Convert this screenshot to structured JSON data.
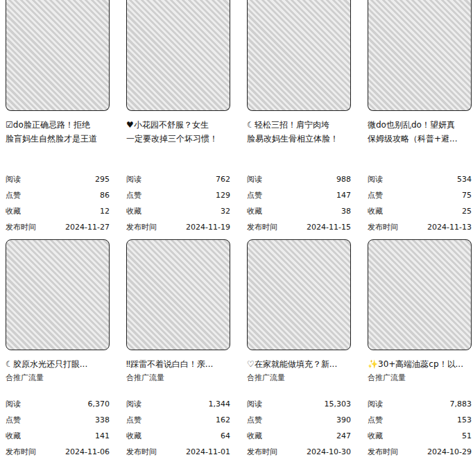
{
  "cards": [
    {
      "title_lines": [
        "☑do脸正确忌路！拒绝",
        "脸盲妈生自然脸才是王道"
      ],
      "tag": "",
      "stats": [
        {
          "label": "阅读",
          "value": "295"
        },
        {
          "label": "点赞",
          "value": "86"
        },
        {
          "label": "收藏",
          "value": "12"
        },
        {
          "label": "发布时间",
          "value": "2024-11-27"
        }
      ]
    },
    {
      "title_lines": [
        "♥小花园不舒服？女生",
        "一定要改掉三个坏习惯！"
      ],
      "tag": "",
      "stats": [
        {
          "label": "阅读",
          "value": "762"
        },
        {
          "label": "点赞",
          "value": "129"
        },
        {
          "label": "收藏",
          "value": "32"
        },
        {
          "label": "发布时间",
          "value": "2024-11-19"
        }
      ]
    },
    {
      "title_lines": [
        "☾轻松三招！肩宁肉垮",
        "脸易改妈生骨相立体脸！"
      ],
      "tag": "",
      "stats": [
        {
          "label": "阅读",
          "value": "988"
        },
        {
          "label": "点赞",
          "value": "147"
        },
        {
          "label": "收藏",
          "value": "38"
        },
        {
          "label": "发布时间",
          "value": "2024-11-15"
        }
      ]
    },
    {
      "title_lines": [
        "微do也别乱do！望妍真",
        "保姆级攻略（科普+避..."
      ],
      "tag": "",
      "stats": [
        {
          "label": "阅读",
          "value": "534"
        },
        {
          "label": "点赞",
          "value": "75"
        },
        {
          "label": "收藏",
          "value": "25"
        },
        {
          "label": "发布时间",
          "value": "2024-11-13"
        }
      ]
    },
    {
      "title_lines": [
        "☾胶原水光还只打眼..."
      ],
      "tag": "合推广流量",
      "stats": [
        {
          "label": "阅读",
          "value": "6,370"
        },
        {
          "label": "点赞",
          "value": "338"
        },
        {
          "label": "收藏",
          "value": "141"
        },
        {
          "label": "发布时间",
          "value": "2024-11-06"
        }
      ]
    },
    {
      "title_lines": [
        "‼踩雷不着说白白！亲..."
      ],
      "tag": "合推广流量",
      "stats": [
        {
          "label": "阅读",
          "value": "1,344"
        },
        {
          "label": "点赞",
          "value": "162"
        },
        {
          "label": "收藏",
          "value": "64"
        },
        {
          "label": "发布时间",
          "value": "2024-11-01"
        }
      ]
    },
    {
      "title_lines": [
        "♡在家就能做填充？新..."
      ],
      "tag": "合推广流量",
      "stats": [
        {
          "label": "阅读",
          "value": "15,303"
        },
        {
          "label": "点赞",
          "value": "390"
        },
        {
          "label": "收藏",
          "value": "247"
        },
        {
          "label": "发布时间",
          "value": "2024-10-30"
        }
      ]
    },
    {
      "title_lines": [
        "✨30+高端油蕊cp！以..."
      ],
      "tag": "合推广流量",
      "stats": [
        {
          "label": "阅读",
          "value": "7,883"
        },
        {
          "label": "点赞",
          "value": "153"
        },
        {
          "label": "收藏",
          "value": "51"
        },
        {
          "label": "发布时间",
          "value": "2024-10-29"
        }
      ]
    }
  ]
}
